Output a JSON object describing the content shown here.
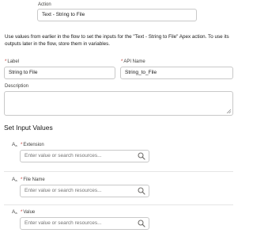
{
  "action": {
    "label": "Action",
    "value": "Text - String to File"
  },
  "description_text": "Use values from earlier in the flow to set the inputs for the \"Text - String to File\" Apex action. To use its outputs later in the flow, store them in variables.",
  "label_field": {
    "required_mark": "*",
    "label": "Label",
    "value": "String to File"
  },
  "api_name_field": {
    "required_mark": "*",
    "label": "API Name",
    "value": "String_to_File"
  },
  "description_field": {
    "label": "Description",
    "value": ""
  },
  "section": {
    "title": "Set Input Values"
  },
  "inputs": [
    {
      "icon_main": "A",
      "icon_sub": "a",
      "required_mark": "*",
      "label": "Extension",
      "placeholder": "Enter value or search resources..."
    },
    {
      "icon_main": "A",
      "icon_sub": "a",
      "required_mark": "*",
      "label": "File Name",
      "placeholder": "Enter value or search resources..."
    },
    {
      "icon_main": "A",
      "icon_sub": "a",
      "required_mark": "*",
      "label": "Value",
      "placeholder": "Enter value or search resources..."
    }
  ],
  "icons": {
    "search": "search-icon",
    "resize": "resize-handle-icon",
    "text_type": "text-type-icon"
  },
  "colors": {
    "required": "#c23934",
    "border": "#c9c9c9",
    "placeholder": "#747474"
  }
}
